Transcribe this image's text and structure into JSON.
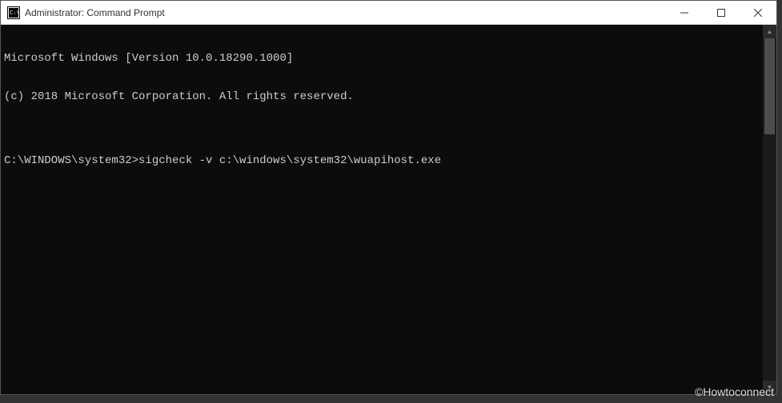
{
  "titlebar": {
    "title": "Administrator: Command Prompt"
  },
  "console": {
    "line1": "Microsoft Windows [Version 10.0.18290.1000]",
    "line2": "(c) 2018 Microsoft Corporation. All rights reserved.",
    "blank": "",
    "prompt": "C:\\WINDOWS\\system32>",
    "command": "sigcheck -v c:\\windows\\system32\\wuapihost.exe"
  },
  "watermark": "©Howtoconnect"
}
